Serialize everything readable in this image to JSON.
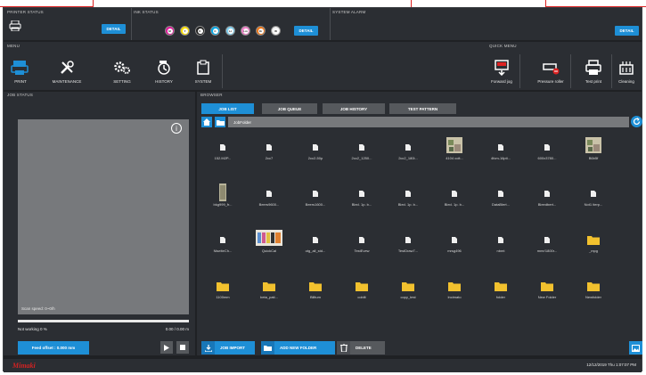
{
  "status_bar": {
    "printer_status_label": "PRINTER STATUS",
    "ink_status_label": "INK STATUS",
    "system_alarm_label": "SYSTEM ALARM",
    "detail_label": "DETAIL"
  },
  "inks": [
    {
      "label": "M",
      "color": "#e0189b"
    },
    {
      "label": "Y",
      "color": "#ffe000"
    },
    {
      "label": "K",
      "color": "#222222"
    },
    {
      "label": "C",
      "color": "#00a8e8"
    },
    {
      "label": "Lc",
      "color": "#7fd0f0"
    },
    {
      "label": "Lm",
      "color": "#f07ec8"
    },
    {
      "label": "Or",
      "color": "#f07818"
    },
    {
      "label": "W",
      "color": "#f0f0f0"
    }
  ],
  "menu": {
    "label": "MENU",
    "items": [
      "PRINT",
      "MAINTENANCE",
      "SETTING",
      "HISTORY",
      "SYSTEM"
    ]
  },
  "quick_menu": {
    "label": "QUICK MENU",
    "items": [
      "Forward jog",
      "Pressure roller",
      "Test print",
      "Cleaning"
    ]
  },
  "job_status": {
    "label": "JOB STATUS",
    "scan_speed": "Scan speed: 0~0/h",
    "state": "Not working  0 %",
    "progress_text": "0.00 / 0.00 m",
    "progress": 0,
    "feed_offset": "Feed offset : 0.000 mm"
  },
  "browser": {
    "label": "BROWSER",
    "tabs": [
      "JOB LIST",
      "JOB QUEUE",
      "JOB HISTORY",
      "TEST PATTERN"
    ],
    "path": "JobFolder",
    "files": [
      {
        "name": "152.M2P...",
        "type": "file"
      },
      {
        "name": "2cc7",
        "type": "file"
      },
      {
        "name": "2cc2-50p",
        "type": "file"
      },
      {
        "name": "2cc2_1250...",
        "type": "file"
      },
      {
        "name": "2cc2_180i...",
        "type": "file"
      },
      {
        "name": "4104 colt...",
        "type": "image"
      },
      {
        "name": "4fcm-16pti...",
        "type": "file"
      },
      {
        "name": "600x3780...",
        "type": "file"
      },
      {
        "name": "B6b5f",
        "type": "image"
      },
      {
        "name": "bkg999_fr...",
        "type": "thumb"
      },
      {
        "name": "Beers9600...",
        "type": "file"
      },
      {
        "name": "Beers1600...",
        "type": "file"
      },
      {
        "name": "Bled. 1p. b...",
        "type": "file"
      },
      {
        "name": "Bled. 1p. b...",
        "type": "file"
      },
      {
        "name": "Bled. 1p. b...",
        "type": "file"
      },
      {
        "name": "DataBlert...",
        "type": "file"
      },
      {
        "name": "Bleedbert...",
        "type": "file"
      },
      {
        "name": "Not1 iterp...",
        "type": "file"
      },
      {
        "name": "NiseiteCh...",
        "type": "file"
      },
      {
        "name": "QuickCal",
        "type": "image"
      },
      {
        "name": "otg_all_std...",
        "type": "file"
      },
      {
        "name": "TestEvew",
        "type": "file"
      },
      {
        "name": "TestDraw7...",
        "type": "file"
      },
      {
        "name": "mrsg496",
        "type": "file"
      },
      {
        "name": "nbmt",
        "type": "file"
      },
      {
        "name": "mmr/1800r...",
        "type": "file"
      },
      {
        "name": "_mpg",
        "type": "folder"
      },
      {
        "name": "1100mm",
        "type": "folder"
      },
      {
        "name": "beta_pati...",
        "type": "folder"
      },
      {
        "name": "Billtum",
        "type": "folder"
      },
      {
        "name": "cobilt",
        "type": "folder"
      },
      {
        "name": "copy_test",
        "type": "folder"
      },
      {
        "name": "Incimato",
        "type": "folder"
      },
      {
        "name": "folder",
        "type": "folder"
      },
      {
        "name": "New Folder",
        "type": "folder"
      },
      {
        "name": "Newfolder",
        "type": "folder"
      }
    ],
    "buttons": [
      "JOB IMPORT",
      "ADD NEW FOLDER",
      "DELETE"
    ]
  },
  "footer": {
    "brand": "Mimaki",
    "datetime": "12/12/2019 Thu 1:07:07 PM"
  },
  "colors": {
    "accent": "#1e8fd6",
    "panel": "#2b2e33",
    "background": "#1f2124",
    "folder": "#f2c12e",
    "brand_red": "#d22222"
  }
}
